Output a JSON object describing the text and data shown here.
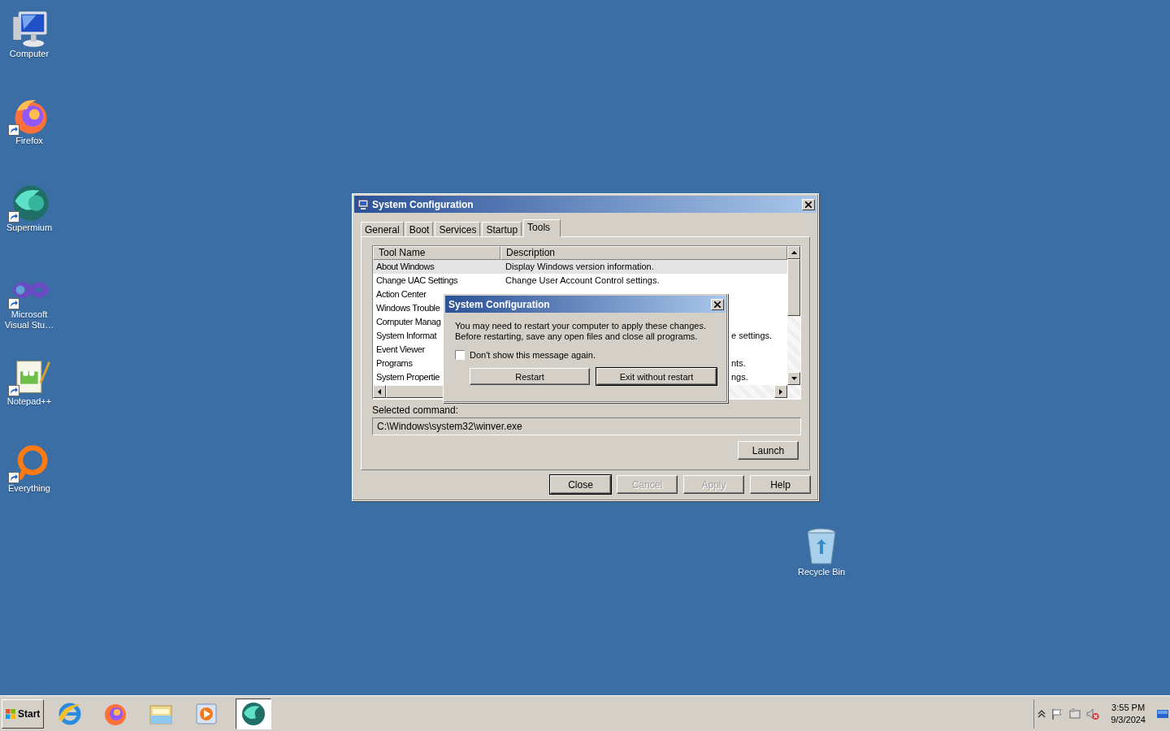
{
  "desktop_icons": [
    {
      "label": "Computer",
      "kind": "computer",
      "shortcut": false
    },
    {
      "label": "Firefox",
      "kind": "firefox",
      "shortcut": true
    },
    {
      "label": "Supermium",
      "kind": "supermium",
      "shortcut": true
    },
    {
      "label": "Microsoft Visual Stu…",
      "kind": "visualstudio",
      "shortcut": true
    },
    {
      "label": "Notepad++",
      "kind": "notepad",
      "shortcut": true
    },
    {
      "label": "Everything",
      "kind": "everything",
      "shortcut": true
    }
  ],
  "recycle_bin": {
    "label": "Recycle Bin"
  },
  "window": {
    "title": "System Configuration",
    "tabs": [
      {
        "label": "General",
        "selected": false
      },
      {
        "label": "Boot",
        "selected": false
      },
      {
        "label": "Services",
        "selected": false
      },
      {
        "label": "Startup",
        "selected": false
      },
      {
        "label": "Tools",
        "selected": true
      }
    ],
    "table": {
      "columns": [
        "Tool Name",
        "Description"
      ],
      "rows": [
        {
          "tool_name": "About Windows",
          "description": "Display Windows version information.",
          "selected": true
        },
        {
          "tool_name": "Change UAC Settings",
          "description": "Change User Account Control settings.",
          "selected": false
        },
        {
          "tool_name": "Action Center",
          "selected": false
        },
        {
          "tool_name": "Windows Trouble",
          "selected": false
        },
        {
          "tool_name": "Computer Manag",
          "selected": false
        },
        {
          "tool_name": "System Informat",
          "description_tail": "e settings.",
          "selected": false
        },
        {
          "tool_name": "Event Viewer",
          "selected": false
        },
        {
          "tool_name": "Programs",
          "description_tail": "nts.",
          "selected": false
        },
        {
          "tool_name": "System Propertie",
          "description_tail": "ngs.",
          "selected": false
        }
      ]
    },
    "selected_command": {
      "label": "Selected command:",
      "value": "C:\\Windows\\system32\\winver.exe"
    },
    "launch_button": "Launch",
    "buttons": [
      {
        "label": "Close",
        "disabled": false,
        "default": true
      },
      {
        "label": "Cancel",
        "disabled": true,
        "default": false
      },
      {
        "label": "Apply",
        "disabled": true,
        "default": false
      },
      {
        "label": "Help",
        "disabled": false,
        "default": false
      }
    ]
  },
  "dialog": {
    "title": "System Configuration",
    "message": [
      "You may need to restart your computer to apply these changes.",
      "Before restarting, save any open files and close all programs."
    ],
    "checkbox": {
      "label": "Don't show this message again.",
      "checked": false
    },
    "buttons": [
      {
        "label": "Restart",
        "default": false
      },
      {
        "label": "Exit without restart",
        "default": true
      }
    ]
  },
  "taskbar": {
    "start": "Start",
    "apps": [
      {
        "kind": "ie",
        "selected": false
      },
      {
        "kind": "firefox",
        "selected": false
      },
      {
        "kind": "explorer",
        "selected": false
      },
      {
        "kind": "media",
        "selected": false
      },
      {
        "kind": "supermium",
        "selected": true
      }
    ],
    "clock": {
      "time": "3:55 PM",
      "date": "9/3/2024"
    }
  }
}
